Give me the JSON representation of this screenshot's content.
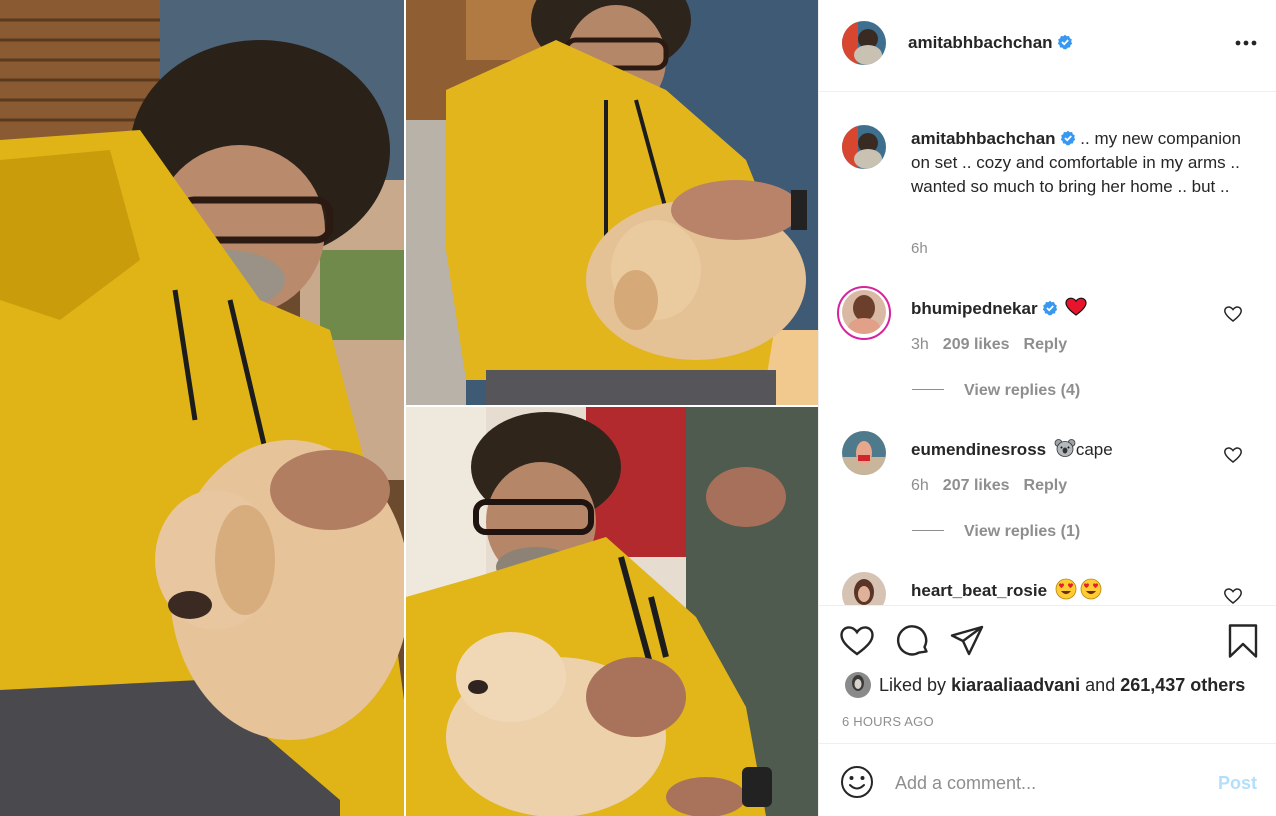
{
  "post": {
    "username": "amitabhbachchan",
    "verified": true,
    "more_icon": "more-horizontal-icon"
  },
  "caption": {
    "username": "amitabhbachchan",
    "text": " .. my new companion on set .. cozy and comfortable in my arms .. wanted so much to bring her home .. but ..",
    "time": "6h"
  },
  "comments": [
    {
      "username": "bhumipednekar",
      "verified": true,
      "emoji": "red-heart",
      "text": "",
      "time": "3h",
      "likes": "209 likes",
      "reply": "Reply",
      "view_replies": "View replies (4)"
    },
    {
      "username": "eumendinesross",
      "verified": false,
      "emoji": "koala",
      "text": "cape",
      "time": "6h",
      "likes": "207 likes",
      "reply": "Reply",
      "view_replies": "View replies (1)"
    },
    {
      "username": "heart_beat_rosie",
      "verified": false,
      "emoji": "heart-eyes-x2",
      "text": ""
    }
  ],
  "actions": {
    "icons": [
      "heart-icon",
      "comment-icon",
      "share-icon",
      "bookmark-icon"
    ],
    "liked_prefix": "Liked by",
    "liked_user": "kiaraaliaadvani",
    "liked_and": "and",
    "liked_others": "261,437 others",
    "timestamp": "6 HOURS AGO"
  },
  "add_comment": {
    "placeholder": "Add a comment...",
    "post_label": "Post"
  },
  "colors": {
    "verified_blue": "#3897f0",
    "post_button_disabled": "#b2dffc",
    "muted_text": "#8e8e8e",
    "heart_red": "#ed4956"
  }
}
